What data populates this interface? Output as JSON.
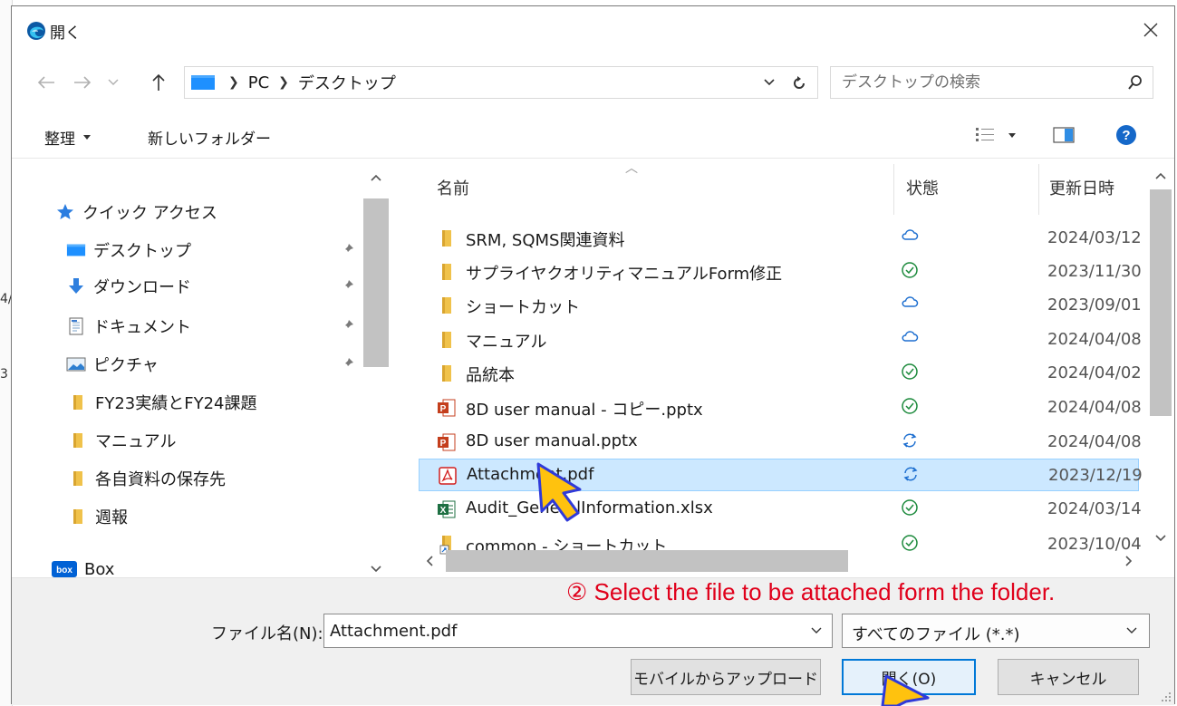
{
  "background": {
    "fragments": [
      "4/",
      "3"
    ]
  },
  "dialog": {
    "title": "開く"
  },
  "navbar": {
    "breadcrumb": [
      "PC",
      "デスクトップ"
    ],
    "search_placeholder": "デスクトップの検索"
  },
  "toolbar": {
    "organize": "整理",
    "new_folder": "新しいフォルダー"
  },
  "nav": {
    "items": [
      {
        "label": "クイック アクセス",
        "icon": "star-icon",
        "pinned": false
      },
      {
        "label": "デスクトップ",
        "icon": "desktop-icon",
        "pinned": true
      },
      {
        "label": "ダウンロード",
        "icon": "download-icon",
        "pinned": true
      },
      {
        "label": "ドキュメント",
        "icon": "document-icon",
        "pinned": true
      },
      {
        "label": "ピクチャ",
        "icon": "pictures-icon",
        "pinned": true
      },
      {
        "label": "FY23実績とFY24課題",
        "icon": "folder-icon",
        "pinned": false
      },
      {
        "label": "マニュアル",
        "icon": "folder-icon",
        "pinned": false
      },
      {
        "label": "各自資料の保存先",
        "icon": "folder-icon",
        "pinned": false
      },
      {
        "label": "週報",
        "icon": "folder-icon",
        "pinned": false
      },
      {
        "label": "Box",
        "icon": "box-icon",
        "pinned": false
      }
    ]
  },
  "files": {
    "headers": {
      "name": "名前",
      "status": "状態",
      "modified": "更新日時"
    },
    "rows": [
      {
        "name": "SRM, SQMS関連資料",
        "type": "folder",
        "status": "cloud",
        "date": "2024/03/12"
      },
      {
        "name": "サプライヤクオリティマニュアルForm修正",
        "type": "folder",
        "status": "synced",
        "date": "2023/11/30"
      },
      {
        "name": "ショートカット",
        "type": "folder",
        "status": "cloud",
        "date": "2023/09/01"
      },
      {
        "name": "マニュアル",
        "type": "folder",
        "status": "cloud",
        "date": "2024/04/08"
      },
      {
        "name": "品統本",
        "type": "folder",
        "status": "synced",
        "date": "2024/04/02"
      },
      {
        "name": "8D user manual - コピー.pptx",
        "type": "pptx",
        "status": "synced",
        "date": "2024/04/08"
      },
      {
        "name": "8D user manual.pptx",
        "type": "pptx",
        "status": "syncing",
        "date": "2024/04/08"
      },
      {
        "name": "Attachment.pdf",
        "type": "pdf",
        "status": "syncing",
        "date": "2023/12/19",
        "selected": true
      },
      {
        "name": "Audit_GeneralInformation.xlsx",
        "type": "xlsx",
        "status": "synced",
        "date": "2024/03/14"
      },
      {
        "name": "common - ショートカット",
        "type": "shortcut",
        "status": "synced",
        "date": "2023/10/04"
      }
    ]
  },
  "bottom": {
    "annotation": "② Select the file to be attached form the folder.",
    "filename_label": "ファイル名(N):",
    "filename_value": "Attachment.pdf",
    "filetype_value": "すべてのファイル (*.*)",
    "upload_button": "モバイルからアップロード",
    "open_button": "開く(O)",
    "cancel_button": "キャンセル"
  },
  "colors": {
    "accent": "#0078d7",
    "selection": "#cce8ff",
    "annotation": "#e0001b",
    "cursor_fill": "#ffc20e",
    "cursor_stroke": "#2f3ad9",
    "folder": "#f0c24b"
  }
}
